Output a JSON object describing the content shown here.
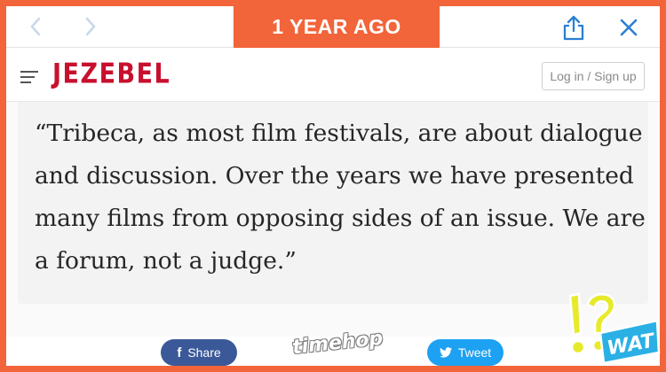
{
  "badge": {
    "label": "1 YEAR AGO"
  },
  "browser": {
    "back_icon": "chevron-left-icon",
    "forward_icon": "chevron-right-icon",
    "share_icon": "share-upload-icon",
    "close_icon": "close-icon"
  },
  "site": {
    "logo": "JEZEBEL",
    "login_label": "Log in / Sign up",
    "menu_icon": "hamburger-menu-icon"
  },
  "article": {
    "quote": "“Tribeca, as most film festivals, are about dialogue and discussion. Over the years we have presented many films from opposing sides of an issue. We are a forum, not a judge.”"
  },
  "footer": {
    "share_label": "Share",
    "tweet_label": "Tweet",
    "brand": "timehop",
    "sticker": "WAT"
  },
  "colors": {
    "frame": "#f2643a",
    "logo": "#c8102e",
    "facebook": "#3b5998",
    "twitter": "#1da1f2",
    "sticker_yellow": "#e7ea2b",
    "sticker_blue": "#2bb0e5"
  }
}
